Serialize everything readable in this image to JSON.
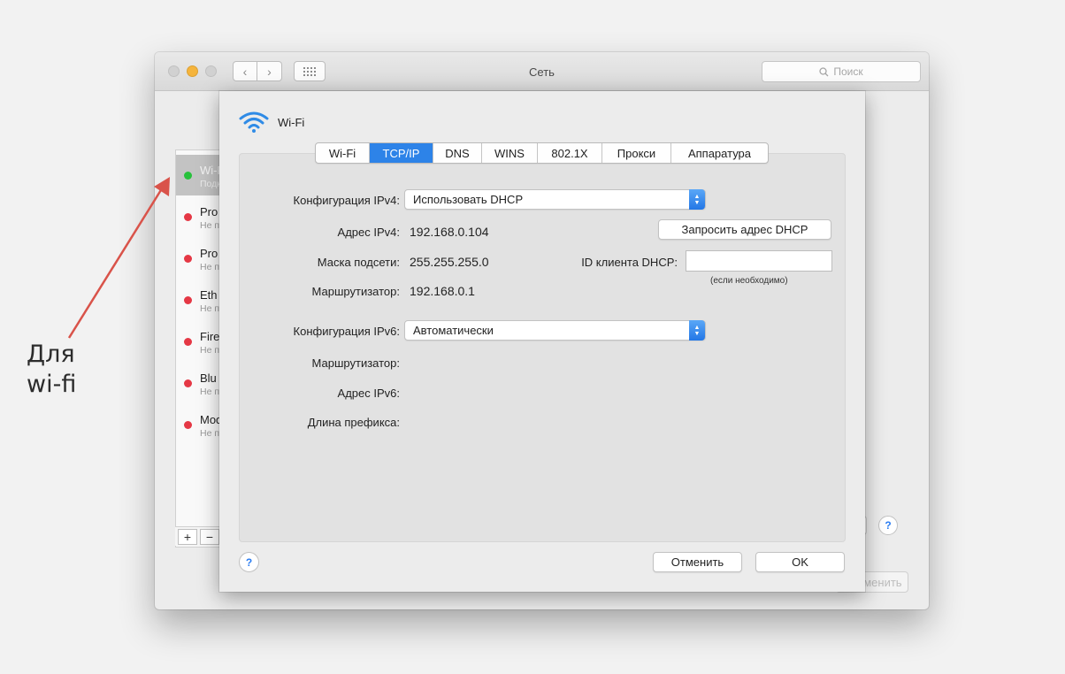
{
  "window": {
    "title": "Сеть",
    "search_placeholder": "Поиск"
  },
  "services": [
    {
      "name": "Wi-Fi",
      "status": "Подключено",
      "state": "connected"
    },
    {
      "name": "Pro",
      "status": "Не подключено",
      "state": "disconnected"
    },
    {
      "name": "Pro",
      "status": "Не подключено",
      "state": "disconnected"
    },
    {
      "name": "Eth",
      "status": "Не подключено",
      "state": "disconnected"
    },
    {
      "name": "Fire",
      "status": "Не подключено",
      "state": "disconnected"
    },
    {
      "name": "Blu",
      "status": "Не подключено",
      "state": "disconnected"
    },
    {
      "name": "Mod",
      "status": "Не подключено",
      "state": "disconnected"
    }
  ],
  "list_footer": {
    "add": "+",
    "remove": "−"
  },
  "outer": {
    "apply_label": "Применить"
  },
  "sheet": {
    "title": "Wi-Fi",
    "tabs": [
      "Wi-Fi",
      "TCP/IP",
      "DNS",
      "WINS",
      "802.1X",
      "Прокси",
      "Аппаратура"
    ],
    "selected_tab": "TCP/IP",
    "ipv4": {
      "config_label": "Конфигурация IPv4:",
      "config_value": "Использовать DHCP",
      "address_label": "Адрес IPv4:",
      "address_value": "192.168.0.104",
      "mask_label": "Маска подсети:",
      "mask_value": "255.255.255.0",
      "router_label": "Маршрутизатор:",
      "router_value": "192.168.0.1",
      "renew_button": "Запросить адрес DHCP",
      "client_id_label": "ID клиента DHCP:",
      "client_id_value": "",
      "client_id_hint": "(если необходимо)"
    },
    "ipv6": {
      "config_label": "Конфигурация IPv6:",
      "config_value": "Автоматически",
      "router_label": "Маршрутизатор:",
      "address_label": "Адрес IPv6:",
      "prefix_label": "Длина префикса:"
    },
    "cancel_button": "Отменить",
    "ok_button": "OK",
    "help": "?"
  },
  "annotation": {
    "line1": "Для",
    "line2": "wi-fi",
    "color": "#d9534a"
  },
  "colors": {
    "accent": "#2d83e8",
    "connected": "#27c13b",
    "disconnected": "#e53845"
  }
}
